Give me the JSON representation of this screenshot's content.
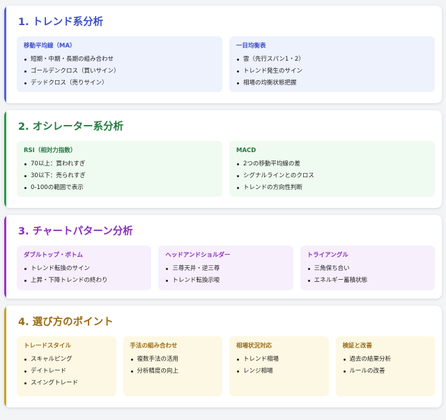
{
  "sections": [
    {
      "title": "1. トレンド系分析",
      "cards": [
        {
          "title": "移動平均線（MA）",
          "items": [
            "短期・中期・長期の組み合わせ",
            "ゴールデンクロス（買いサイン）",
            "デッドクロス（売りサイン）"
          ]
        },
        {
          "title": "一目均衡表",
          "items": [
            "雲（先行スパン1・2）",
            "トレンド発生のサイン",
            "相場の均衡状態把握"
          ]
        }
      ]
    },
    {
      "title": "2. オシレーター系分析",
      "cards": [
        {
          "title": "RSI（相対力指数）",
          "items": [
            "70以上：買われすぎ",
            "30以下：売られすぎ",
            "0-100の範囲で表示"
          ]
        },
        {
          "title": "MACD",
          "items": [
            "2つの移動平均線の差",
            "シグナルラインとのクロス",
            "トレンドの方向性判断"
          ]
        }
      ]
    },
    {
      "title": "3. チャートパターン分析",
      "cards": [
        {
          "title": "ダブルトップ・ボトム",
          "items": [
            "トレンド転換のサイン",
            "上昇・下降トレンドの終わり"
          ]
        },
        {
          "title": "ヘッドアンドショルダー",
          "items": [
            "三尊天井・逆三尊",
            "トレンド転換示唆"
          ]
        },
        {
          "title": "トライアングル",
          "items": [
            "三角保ち合い",
            "エネルギー蓄積状態"
          ]
        }
      ]
    },
    {
      "title": "4. 選び方のポイント",
      "cards": [
        {
          "title": "トレードスタイル",
          "items": [
            "スキャルピング",
            "デイトレード",
            "スイングトレード"
          ]
        },
        {
          "title": "手法の組み合わせ",
          "items": [
            "複数手法の活用",
            "分析精度の向上"
          ]
        },
        {
          "title": "相場状況対応",
          "items": [
            "トレンド相場",
            "レンジ相場"
          ]
        },
        {
          "title": "検証と改善",
          "items": [
            "過去の結果分析",
            "ルールの改善"
          ]
        }
      ]
    }
  ],
  "accent_colors": [
    "#4f63d9",
    "#2e9a4e",
    "#9a35c9",
    "#c9a227"
  ]
}
